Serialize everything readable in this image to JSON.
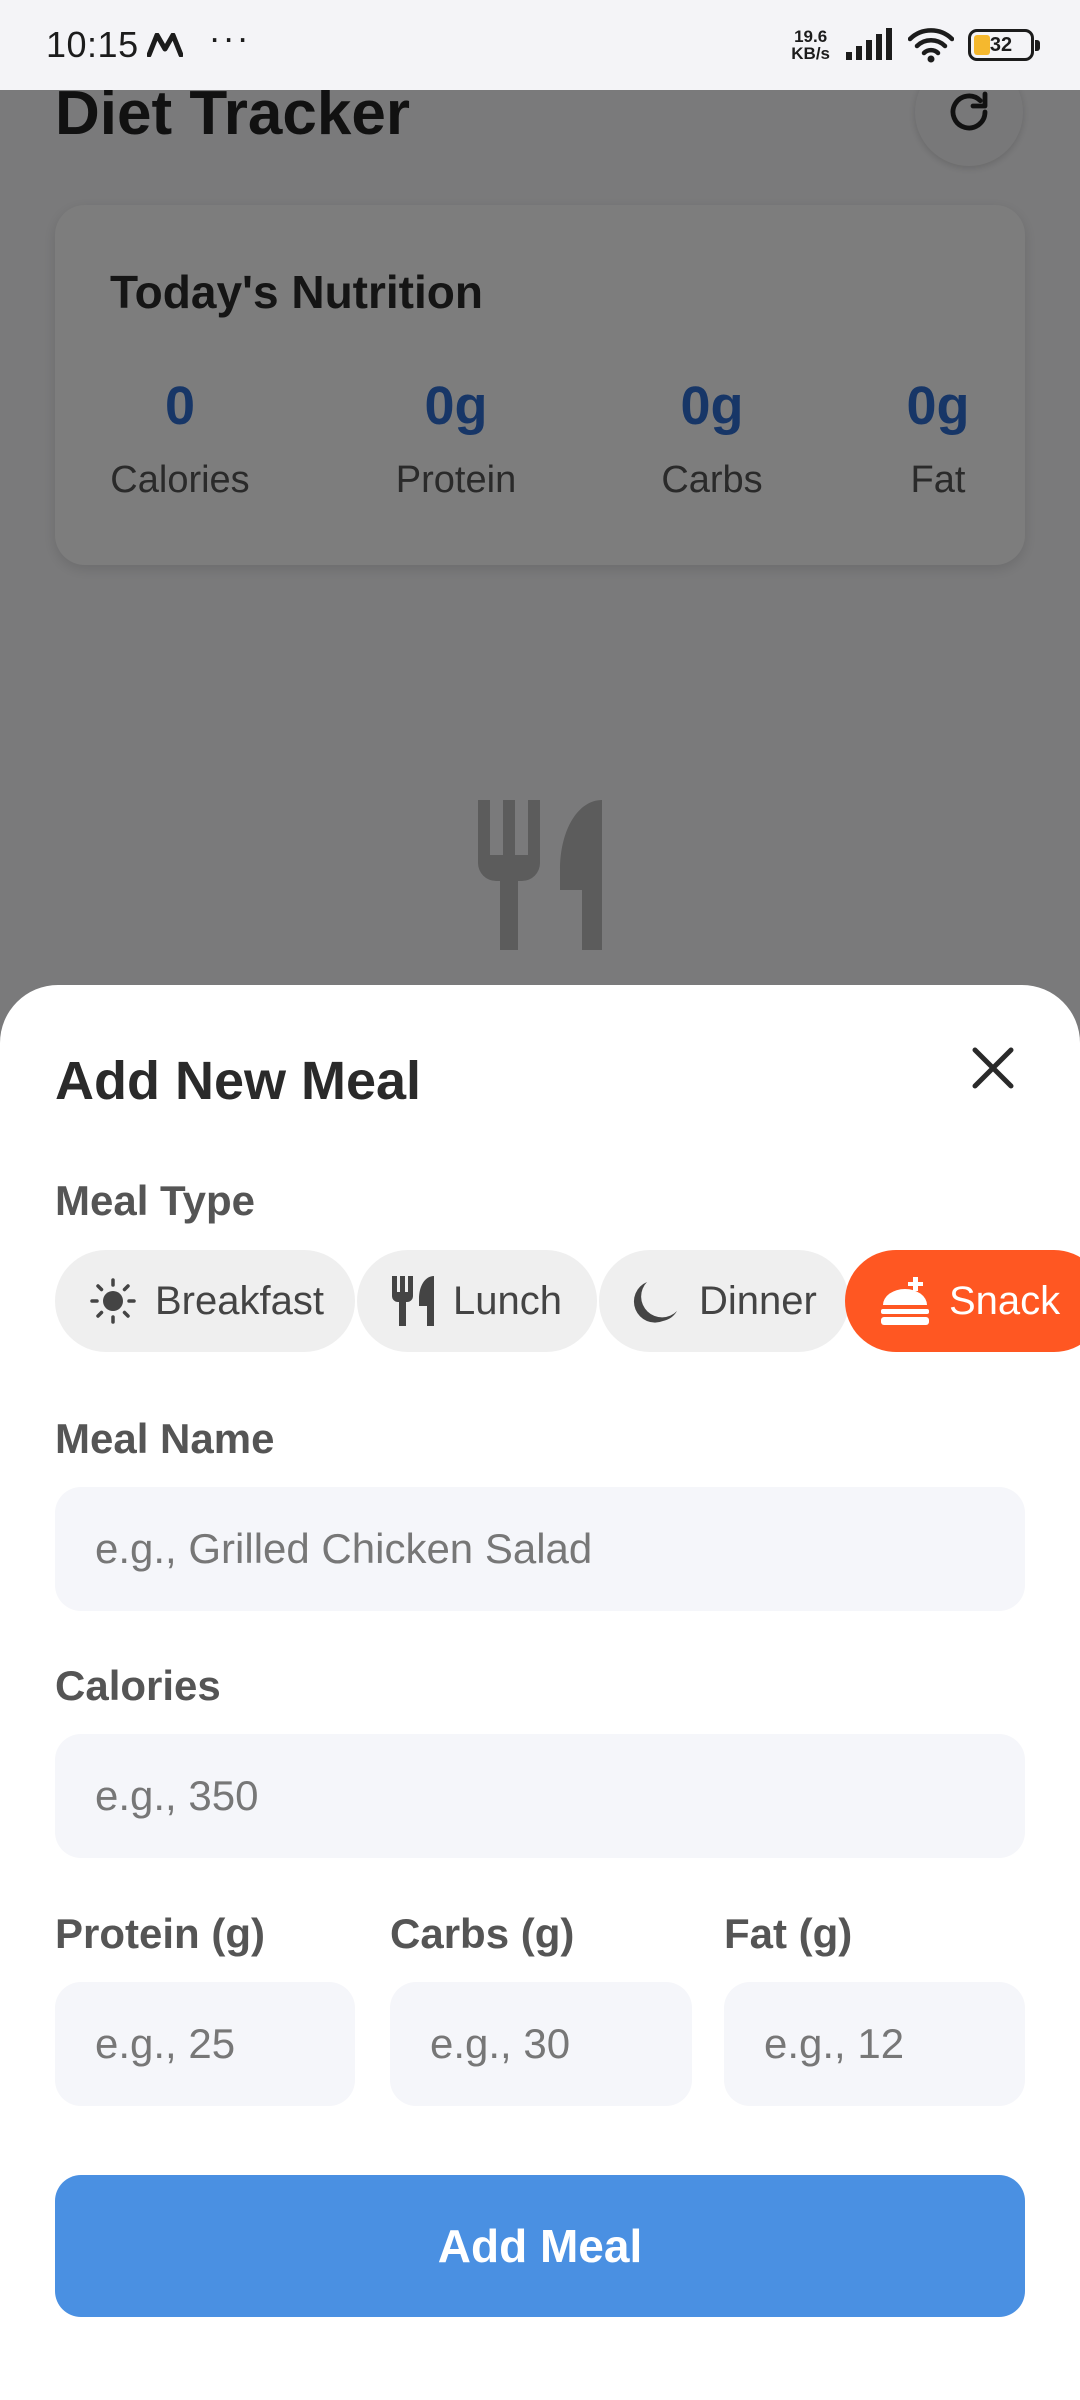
{
  "status_bar": {
    "time": "10:15",
    "net_speed_value": "19.6",
    "net_speed_unit": "KB/s",
    "battery_level": "32"
  },
  "app": {
    "title": "Diet Tracker",
    "summary": {
      "title": "Today's Nutrition",
      "stats": [
        {
          "value": "0",
          "label": "Calories"
        },
        {
          "value": "0g",
          "label": "Protein"
        },
        {
          "value": "0g",
          "label": "Carbs"
        },
        {
          "value": "0g",
          "label": "Fat"
        }
      ]
    }
  },
  "sheet": {
    "title": "Add New Meal",
    "meal_type_label": "Meal Type",
    "meal_types": [
      {
        "label": "Breakfast",
        "icon": "sun-icon",
        "selected": false
      },
      {
        "label": "Lunch",
        "icon": "utensils-icon",
        "selected": false
      },
      {
        "label": "Dinner",
        "icon": "moon-icon",
        "selected": false
      },
      {
        "label": "Snack",
        "icon": "burger-icon",
        "selected": true
      }
    ],
    "meal_name": {
      "label": "Meal Name",
      "placeholder": "e.g., Grilled Chicken Salad",
      "value": ""
    },
    "calories": {
      "label": "Calories",
      "placeholder": "e.g., 350",
      "value": ""
    },
    "protein": {
      "label": "Protein (g)",
      "placeholder": "e.g., 25",
      "value": ""
    },
    "carbs": {
      "label": "Carbs (g)",
      "placeholder": "e.g., 30",
      "value": ""
    },
    "fat": {
      "label": "Fat (g)",
      "placeholder": "e.g., 12",
      "value": ""
    },
    "submit_label": "Add Meal"
  },
  "colors": {
    "accent_blue": "#4a90e2",
    "stat_blue": "#2f6dcf",
    "selected_chip": "#ff5722",
    "overlay": "rgba(0,0,0,0.5)"
  }
}
